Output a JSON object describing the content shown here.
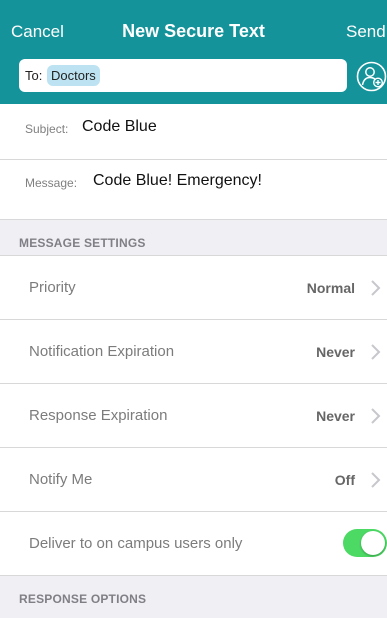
{
  "nav": {
    "cancel": "Cancel",
    "title": "New Secure Text",
    "send": "Send"
  },
  "to_field": {
    "label": "To:",
    "recipient": "Doctors"
  },
  "compose": {
    "subject_label": "Subject:",
    "subject_value": "Code Blue",
    "message_label": "Message:",
    "message_value": "Code Blue! Emergency!"
  },
  "message_settings": {
    "header": "MESSAGE SETTINGS",
    "rows": [
      {
        "label": "Priority",
        "value": "Normal"
      },
      {
        "label": "Notification Expiration",
        "value": "Never"
      },
      {
        "label": "Response Expiration",
        "value": "Never"
      },
      {
        "label": "Notify Me",
        "value": "Off"
      }
    ],
    "campus_toggle": {
      "label": "Deliver to on campus users only",
      "on": true
    }
  },
  "response_options": {
    "header": "RESPONSE OPTIONS"
  },
  "colors": {
    "brand_teal": "#14939a",
    "toggle_on": "#4cd964",
    "chip_blue": "#bde3f2"
  }
}
